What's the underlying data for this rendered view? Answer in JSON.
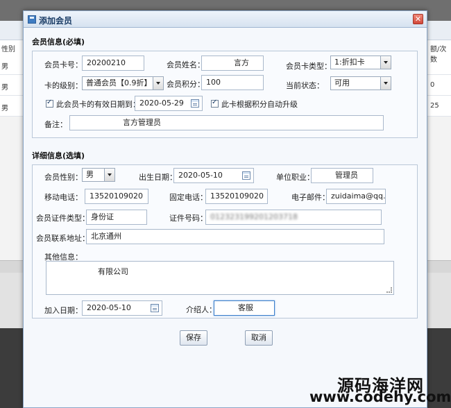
{
  "background": {
    "header_partial_left": "性别",
    "header_partial_right": "额/次数",
    "rows": [
      {
        "left": "男",
        "right": ""
      },
      {
        "left": "男",
        "right": "0"
      },
      {
        "left": "男",
        "right": "25"
      }
    ]
  },
  "modal": {
    "title": "添加会员",
    "close_icon": "close-icon"
  },
  "member_info": {
    "section_title": "会员信息(必填)",
    "card_no_label": "会员卡号：",
    "card_no_value": "20200210",
    "name_label": "会员姓名：",
    "name_value": "言方",
    "card_type_label": "会员卡类型：",
    "card_type_value": "1:折扣卡",
    "level_label": "卡的级别：",
    "level_value": "普通会员【0.9折】",
    "points_label": "会员积分：",
    "points_value": "100",
    "status_label": "当前状态：",
    "status_value": "可用",
    "expire_check_label": "此会员卡的有效日期到：",
    "expire_date": "2020-05-29",
    "auto_upgrade_label": "此卡根据积分自动升级",
    "remark_label": "备注：",
    "remark_value": "言方管理员"
  },
  "detail_info": {
    "section_title": "详细信息(选填)",
    "gender_label": "会员性别：",
    "gender_value": "男",
    "birthday_label": "出生日期：",
    "birthday_value": "2020-05-10",
    "job_label": "单位职业：",
    "job_value": "管理员",
    "mobile_label": "移动电话：",
    "mobile_value": "13520109020",
    "phone_label": "固定电话：",
    "phone_value": "13520109020",
    "email_label": "电子邮件：",
    "email_value": "zuidaima@qq.c",
    "id_type_label": "会员证件类型：",
    "id_type_value": "身份证",
    "id_no_label": "证件号码：",
    "id_no_value": "012323199201203718",
    "address_label": "会员联系地址：",
    "address_value": "北京通州",
    "other_label": "其他信息：",
    "other_value": "有限公司",
    "join_date_label": "加入日期：",
    "join_date_value": "2020-05-10",
    "referrer_label": "介绍人：",
    "referrer_value": "客服"
  },
  "buttons": {
    "save": "保存",
    "cancel": "取消"
  },
  "watermark": {
    "line1": "源码海洋网",
    "line2": "www.codehy.com"
  }
}
